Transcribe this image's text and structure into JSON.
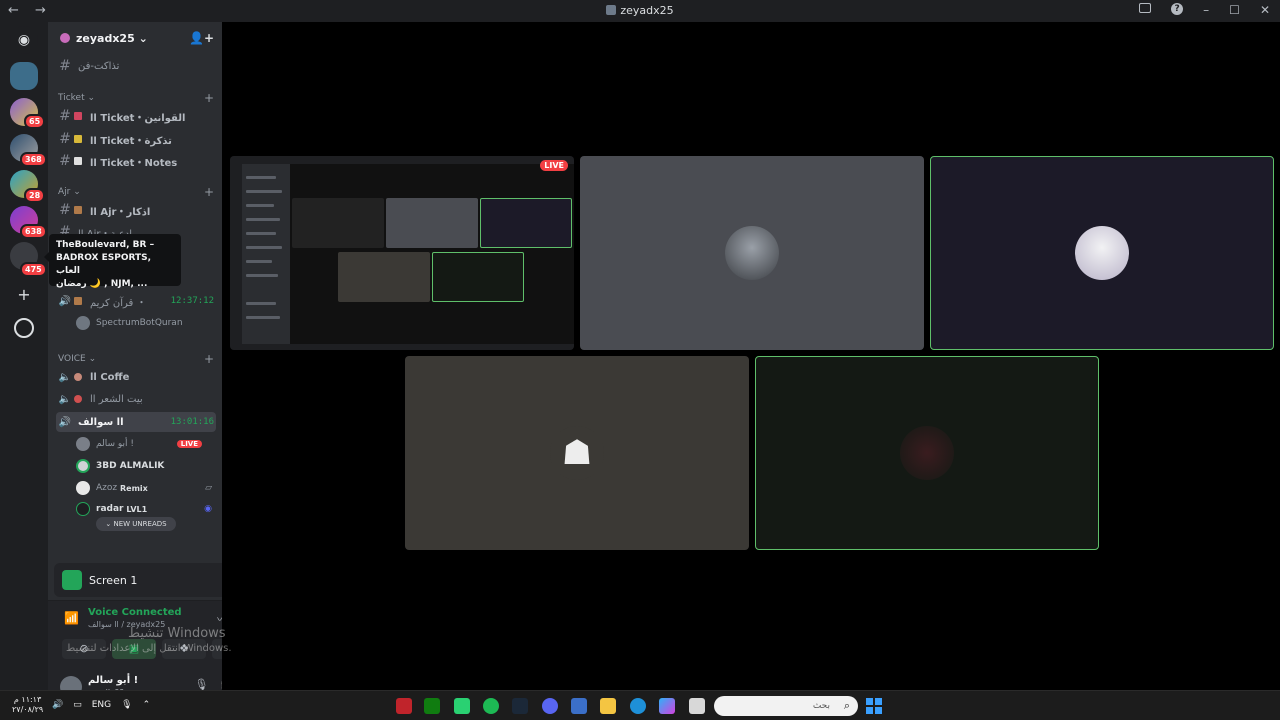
{
  "window": {
    "title": "zeyadx25"
  },
  "guild": {
    "name": "zeyadx25"
  },
  "server_badges": [
    "65",
    "368",
    "28",
    "638",
    "475"
  ],
  "tooltip": {
    "line1": "TheBoulevard, BR –",
    "line2": "BADROX ESPORTS, العاب",
    "line3": "رمضان 🌙 , NJM, ..."
  },
  "channels": {
    "top": "تذاكت-فن",
    "cat_ticket": "Ticket",
    "ticket1": "ll Ticket・القوانين",
    "ticket2": "ll Ticket・تذكرة",
    "ticket3": "ll Ticket・Notes",
    "cat_ajr": "Ajr",
    "ajr1": "ll Ajr・اذكار",
    "ajr2": "ll Ajr・ادعية",
    "quran": "قرآن كريم ・",
    "quran_time": "12:37:12",
    "quran_bot": "SpectrumBotQuran",
    "cat_voice": "VOICE",
    "coffe": "ll Coffe",
    "shisha": "ll بيت الشعر",
    "sawalef": "سوالف ll",
    "sawalef_time": "13:01:16"
  },
  "members": [
    {
      "name": "أبو سالم !",
      "live": "LIVE"
    },
    {
      "name": "3BD ALMALIK"
    },
    {
      "name": "Azoz",
      "tag": "Remix"
    },
    {
      "name": "radar",
      "tag": "LVL1"
    }
  ],
  "new_unreads": "NEW UNREADS",
  "screen_share": {
    "name": "Screen 1"
  },
  "voice": {
    "status": "Voice Connected",
    "sub": "سوالف ll / zeyadx25"
  },
  "user": {
    "name": "أبو سالم !",
    "status": "emoji_60"
  },
  "watermark": {
    "line1": "تنشيط Windows",
    "line2": "انتقل إلى الإعدادات لتنشيط Windows."
  },
  "stream": {
    "live_label": "LIVE"
  },
  "taskbar": {
    "time": "١١:١٣ م",
    "date": "٢٧/٠٨/٢٩",
    "lang": "ENG",
    "search_placeholder": "بحث"
  },
  "colors": {
    "accent_green": "#23a559",
    "live_red": "#f23f43",
    "blurple": "#5865f2"
  }
}
